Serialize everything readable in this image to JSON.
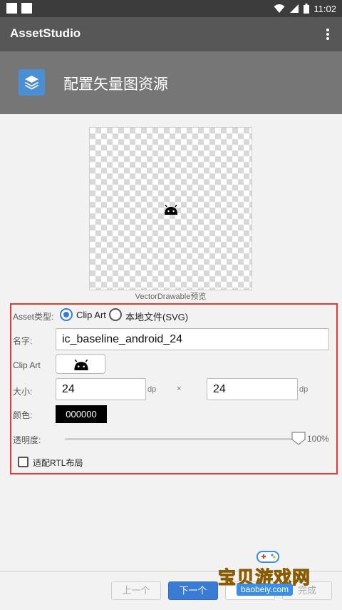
{
  "status_bar": {
    "time": "11:02"
  },
  "app_bar": {
    "title": "AssetStudio"
  },
  "header": {
    "title": "配置矢量图资源"
  },
  "preview": {
    "caption": "VectorDrawable预览"
  },
  "form": {
    "asset_type_label": "Asset类型:",
    "asset_type_options": [
      "Clip Art",
      "本地文件(SVG)"
    ],
    "asset_type_selected": "Clip Art",
    "name_label": "名字:",
    "name_value": "ic_baseline_android_24",
    "clipart_label": "Clip Art",
    "size_label": "大小:",
    "width_value": "24",
    "height_value": "24",
    "unit": "dp",
    "times": "×",
    "color_label": "颜色:",
    "color_value": "000000",
    "opacity_label": "透明度:",
    "opacity_value": "100%",
    "opacity_fraction": 1.0,
    "rtl_label": "适配RTL布局",
    "rtl_checked": false
  },
  "buttons": {
    "prev": "上一个",
    "next": "下一个",
    "cancel": "取消",
    "finish": "完成"
  },
  "watermark": {
    "text": "宝贝游戏网",
    "url": "baobeiy.com"
  },
  "colors": {
    "accent": "#3a7bd5",
    "highlight_border": "#e53935",
    "app_bar": "#575757",
    "banner": "#767676"
  },
  "icons": [
    "wifi-icon",
    "signal-icon",
    "battery-icon",
    "overflow-menu-icon",
    "layers-icon",
    "android-icon"
  ]
}
